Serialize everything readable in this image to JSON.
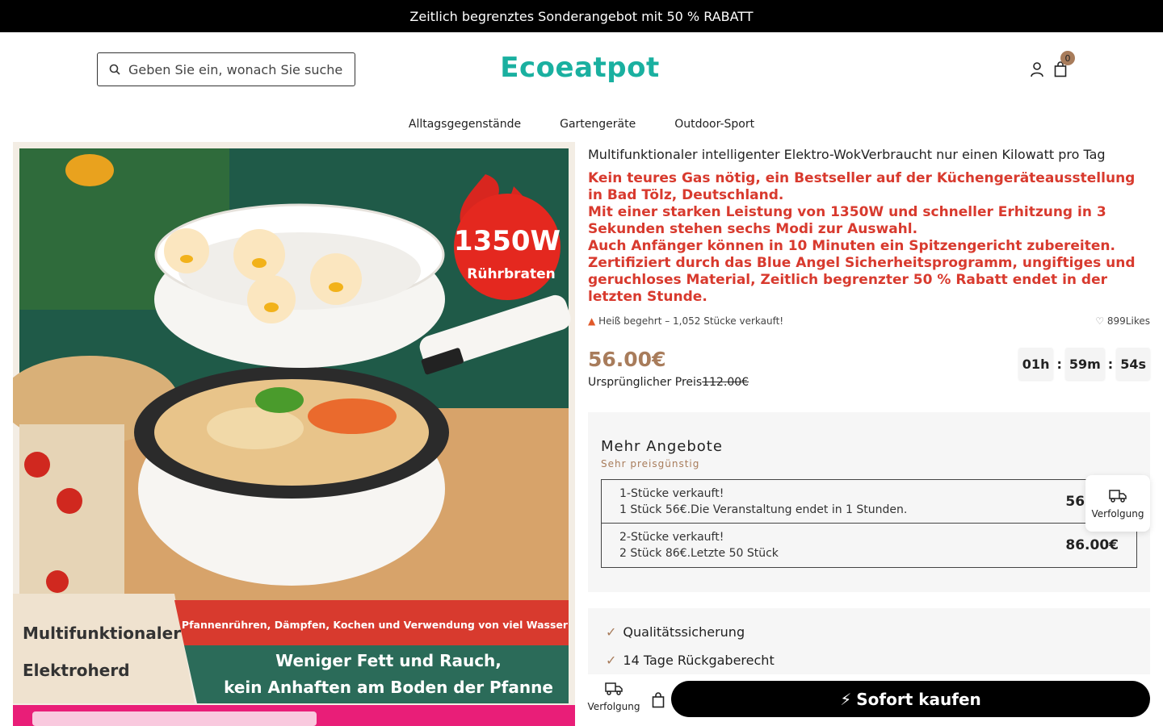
{
  "announcement": "Zeitlich begrenztes Sonderangebot mit 50 % RABATT",
  "header": {
    "search_placeholder": "Geben Sie ein, wonach Sie suche",
    "logo": "Ecoeatpot",
    "cart_count": "0"
  },
  "nav": [
    "Alltagsgegenstände",
    "Gartengeräte",
    "Outdoor-Sport"
  ],
  "gallery": {
    "badge_power": "1350W",
    "badge_mode": "Rührbraten",
    "left_line1": "Multifunktionaler",
    "left_line2": "Elektroherd",
    "red_banner": "Pfannenrühren, Dämpfen, Kochen und Verwendung von viel Wasser",
    "green_line1": "Weniger Fett und Rauch,",
    "green_line2": "kein Anhaften am Boden der Pfanne"
  },
  "product": {
    "title": "Multifunktionaler intelligenter Elektro-WokVerbraucht nur einen Kilowatt pro Tag",
    "desc_lines": [
      "Kein teures Gas nötig, ein Bestseller auf der Küchengeräteausstellung in Bad Tölz, Deutschland.",
      "Mit einer starken Leistung von 1350W und schneller Erhitzung in 3 Sekunden stehen sechs Modi zur Auswahl.",
      "Auch Anfänger können in 10 Minuten ein Spitzengericht zubereiten.",
      "Zertifiziert durch das Blue Angel Sicherheitsprogramm, ungiftiges und geruchloses Material, Zeitlich begrenzter 50 % Rabatt endet in der letzten Stunde."
    ],
    "sold_text": "Heiß begehrt – 1,052 Stücke verkauft!",
    "likes_text": "899Likes",
    "price": "56.00€",
    "orig_label": "Ursprünglicher Preis",
    "orig_price": "112.00€",
    "timer": {
      "h": "01h",
      "m": "59m",
      "s": "54s",
      "sep": ":"
    }
  },
  "offers": {
    "title": "Mehr Angebote",
    "subtitle": "Sehr preisgünstig",
    "options": [
      {
        "line1": "1-Stücke verkauft!",
        "line2": "1 Stück 56€.Die Veranstaltung endet in 1 Stunden.",
        "price": "56.00€"
      },
      {
        "line1": "2-Stücke verkauft!",
        "line2": "2 Stück 86€.Letzte 50 Stück",
        "price": "86.00€"
      }
    ]
  },
  "guarantees": [
    "Qualitätssicherung",
    "14 Tage Rückgaberecht"
  ],
  "tracking_label": "Verfolgung",
  "buy_label": "Sofort kaufen",
  "colors": {
    "accent": "#a87c5b",
    "logo": "#1ab0a0",
    "promo_red": "#d83a2e"
  },
  "icons": [
    "search-icon",
    "user-icon",
    "cart-icon",
    "fire-icon",
    "heart-icon",
    "truck-icon",
    "check-icon",
    "lightning-icon"
  ]
}
